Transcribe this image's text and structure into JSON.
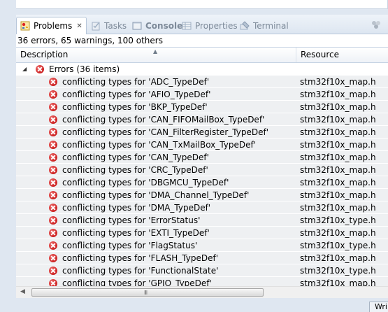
{
  "tabs": [
    {
      "label": "Problems",
      "icon": "problems-icon",
      "active": true,
      "closable": true
    },
    {
      "label": "Tasks",
      "icon": "tasks-icon"
    },
    {
      "label": "Console",
      "icon": "console-icon",
      "bold": true
    },
    {
      "label": "Properties",
      "icon": "properties-icon"
    },
    {
      "label": "Terminal",
      "icon": "terminal-icon"
    }
  ],
  "summary": "36 errors, 65 warnings, 100 others",
  "table": {
    "columns": [
      "Description",
      "Resource"
    ],
    "group": {
      "label": "Errors (36 items)",
      "expanded": true
    },
    "rows": [
      {
        "description": "conflicting types for 'ADC_TypeDef'",
        "resource": "stm32f10x_map.h"
      },
      {
        "description": "conflicting types for 'AFIO_TypeDef'",
        "resource": "stm32f10x_map.h"
      },
      {
        "description": "conflicting types for 'BKP_TypeDef'",
        "resource": "stm32f10x_map.h"
      },
      {
        "description": "conflicting types for 'CAN_FIFOMailBox_TypeDef'",
        "resource": "stm32f10x_map.h"
      },
      {
        "description": "conflicting types for 'CAN_FilterRegister_TypeDef'",
        "resource": "stm32f10x_map.h"
      },
      {
        "description": "conflicting types for 'CAN_TxMailBox_TypeDef'",
        "resource": "stm32f10x_map.h"
      },
      {
        "description": "conflicting types for 'CAN_TypeDef'",
        "resource": "stm32f10x_map.h"
      },
      {
        "description": "conflicting types for 'CRC_TypeDef'",
        "resource": "stm32f10x_map.h"
      },
      {
        "description": "conflicting types for 'DBGMCU_TypeDef'",
        "resource": "stm32f10x_map.h"
      },
      {
        "description": "conflicting types for 'DMA_Channel_TypeDef'",
        "resource": "stm32f10x_map.h"
      },
      {
        "description": "conflicting types for 'DMA_TypeDef'",
        "resource": "stm32f10x_map.h"
      },
      {
        "description": "conflicting types for 'ErrorStatus'",
        "resource": "stm32f10x_type.h"
      },
      {
        "description": "conflicting types for 'EXTI_TypeDef'",
        "resource": "stm32f10x_map.h"
      },
      {
        "description": "conflicting types for 'FlagStatus'",
        "resource": "stm32f10x_type.h"
      },
      {
        "description": "conflicting types for 'FLASH_TypeDef'",
        "resource": "stm32f10x_map.h"
      },
      {
        "description": "conflicting types for 'FunctionalState'",
        "resource": "stm32f10x_type.h"
      },
      {
        "description": "conflicting types for 'GPIO_TypeDef'",
        "resource": "stm32f10x_map.h"
      }
    ]
  },
  "scrollbar": {
    "grip": "III"
  },
  "status": {
    "text": "Wri"
  },
  "colors": {
    "frame": "#dfe7f1",
    "row_bg": "#eef0f2",
    "error": "#cc1f1f",
    "tab_inactive_text": "#7d8a99"
  }
}
